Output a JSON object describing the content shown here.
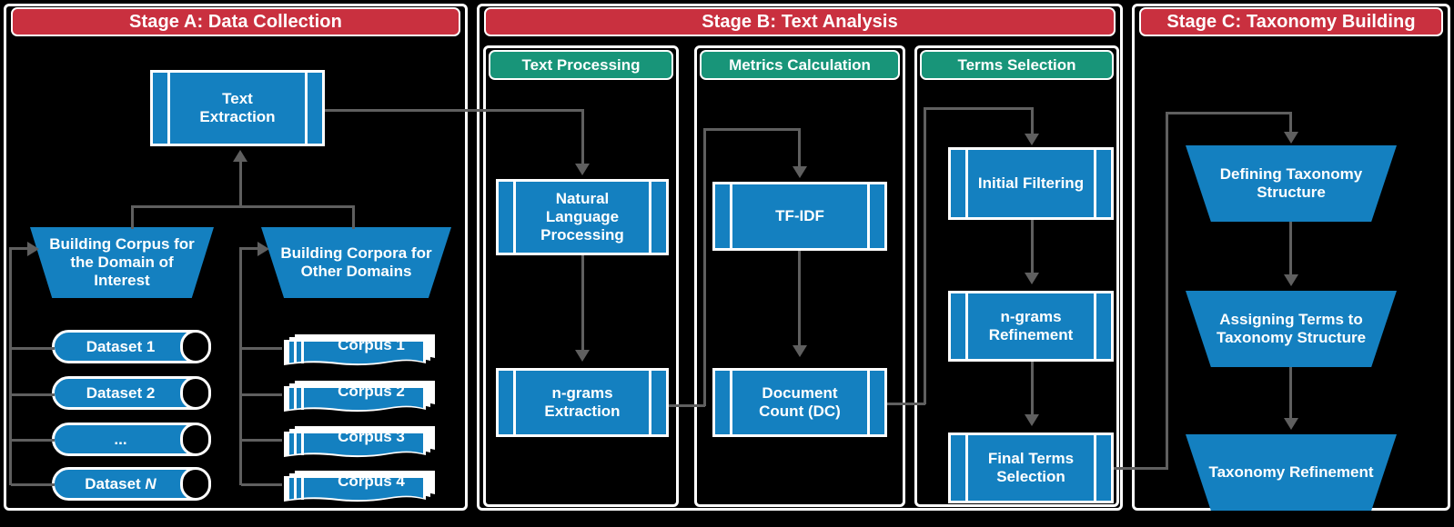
{
  "colors": {
    "stage_header": "#c9303f",
    "substage_header": "#189579",
    "node_fill": "#1480c0",
    "connector": "#5f5f5f",
    "background": "#000000",
    "outline": "#ffffff"
  },
  "stages": [
    {
      "id": "A",
      "title": "Stage A: Data Collection"
    },
    {
      "id": "B",
      "title": "Stage B: Text Analysis"
    },
    {
      "id": "C",
      "title": "Stage C: Taxonomy Building"
    }
  ],
  "substages": [
    {
      "id": "text-processing",
      "title": "Text Processing"
    },
    {
      "id": "metrics-calculation",
      "title": "Metrics Calculation"
    },
    {
      "id": "terms-selection",
      "title": "Terms Selection"
    }
  ],
  "nodes": {
    "text_extraction": "Text\nExtraction",
    "building_corpus_doi": "Building Corpus for\nthe Domain of\nInterest",
    "building_corpora_other": "Building Corpora for\nOther Domains",
    "nlp": "Natural\nLanguage\nProcessing",
    "ngrams_extraction": "n-grams\nExtraction",
    "tfidf": "TF-IDF",
    "document_count": "Document\nCount (DC)",
    "initial_filtering": "Initial Filtering",
    "ngrams_refinement": "n-grams\nRefinement",
    "final_terms_selection": "Final Terms\nSelection",
    "defining_taxonomy": "Defining Taxonomy\nStructure",
    "assigning_terms": "Assigning Terms to\nTaxonomy Structure",
    "taxonomy_refinement": "Taxonomy Refinement"
  },
  "datasets": [
    {
      "label": "Dataset 1"
    },
    {
      "label": "Dataset 2"
    },
    {
      "label": "..."
    },
    {
      "label": "Dataset N",
      "italic_tail": "N"
    }
  ],
  "corpora": [
    {
      "label": "Corpus 1"
    },
    {
      "label": "Corpus 2"
    },
    {
      "label": "Corpus 3"
    },
    {
      "label": "Corpus 4"
    }
  ]
}
